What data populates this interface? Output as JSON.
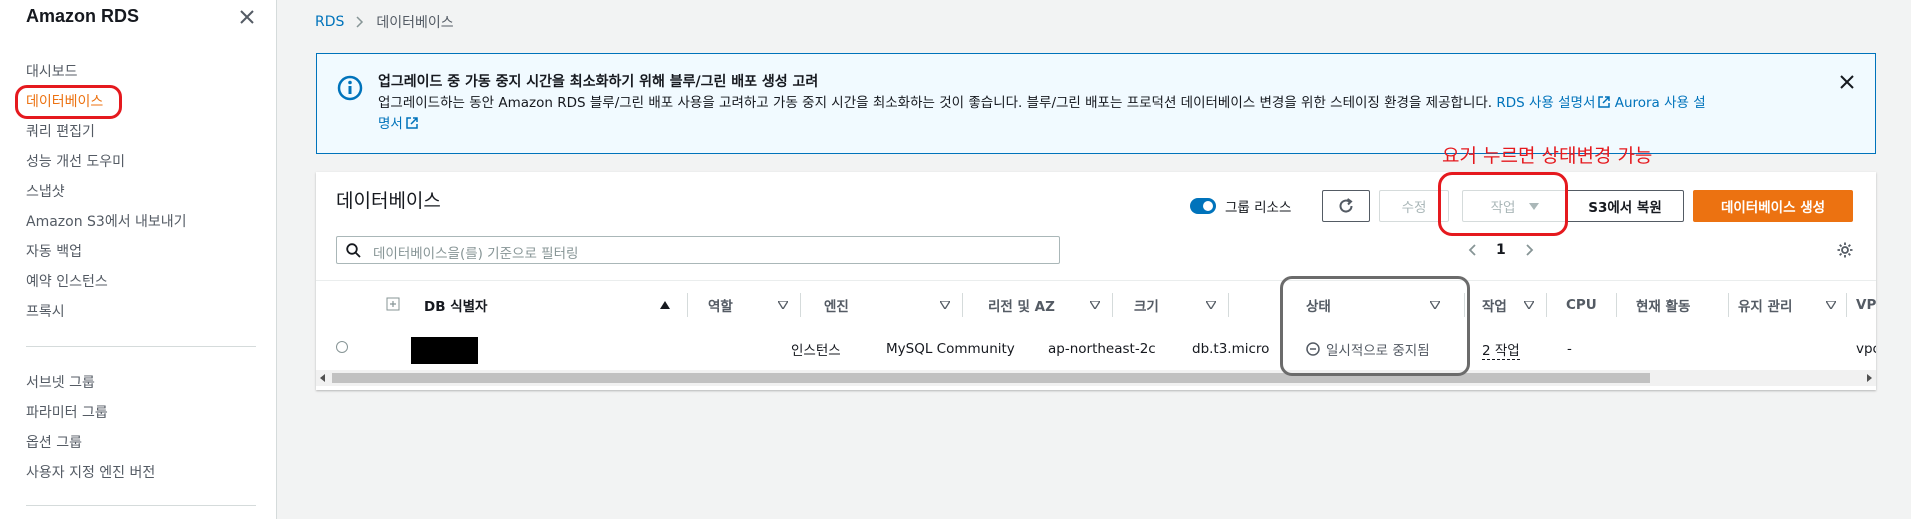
{
  "sidebar": {
    "title": "Amazon RDS",
    "items": [
      {
        "label": "대시보드",
        "active": false
      },
      {
        "label": "데이터베이스",
        "active": true
      },
      {
        "label": "쿼리 편집기",
        "active": false
      },
      {
        "label": "성능 개선 도우미",
        "active": false
      },
      {
        "label": "스냅샷",
        "active": false
      },
      {
        "label": "Amazon S3에서 내보내기",
        "active": false
      },
      {
        "label": "자동 백업",
        "active": false
      },
      {
        "label": "예약 인스턴스",
        "active": false
      },
      {
        "label": "프록시",
        "active": false
      }
    ],
    "items2": [
      {
        "label": "서브넷 그룹"
      },
      {
        "label": "파라미터 그룹"
      },
      {
        "label": "옵션 그룹"
      },
      {
        "label": "사용자 지정 엔진 버전"
      }
    ]
  },
  "breadcrumb": {
    "root": "RDS",
    "current": "데이터베이스"
  },
  "banner": {
    "title": "업그레이드 중 가동 중지 시간을 최소화하기 위해 블루/그린 배포 생성 고려",
    "text": "업그레이드하는 동안 Amazon RDS 블루/그린 배포 사용을 고려하고 가동 중지 시간을 최소화하는 것이 좋습니다. 블루/그린 배포는 프로덕션 데이터베이스 변경을 위한 스테이징 환경을 제공합니다.",
    "link1": "RDS 사용 설명서",
    "link2_part1": "Aurora 사용 설",
    "link2_part2": "명서"
  },
  "annotation": "요거 누르면 상태변경 가능",
  "panel": {
    "title": "데이터베이스",
    "group_resources_label": "그룹 리소스",
    "edit_label": "수정",
    "action_label": "작업",
    "restore_s3_label": "S3에서 복원",
    "create_label": "데이터베이스 생성",
    "search_placeholder": "데이터베이스을(를) 기준으로 필터링",
    "page": "1"
  },
  "table": {
    "headers": {
      "db_id": "DB 식별자",
      "role": "역할",
      "engine": "엔진",
      "region": "리전 및 AZ",
      "size": "크기",
      "status": "상태",
      "actions": "작업",
      "cpu": "CPU",
      "activity": "현재 활동",
      "maintenance": "유지 관리",
      "vpc": "VPC"
    },
    "rows": [
      {
        "role": "인스턴스",
        "engine": "MySQL Community",
        "region": "ap-northeast-2c",
        "size": "db.t3.micro",
        "status": "일시적으로 중지됨",
        "actions": "2 작업",
        "cpu": "-",
        "vpc": "vpc"
      }
    ]
  },
  "colors": {
    "accent": "#ec7211",
    "link": "#0073bb",
    "annotation": "#e5191e"
  }
}
